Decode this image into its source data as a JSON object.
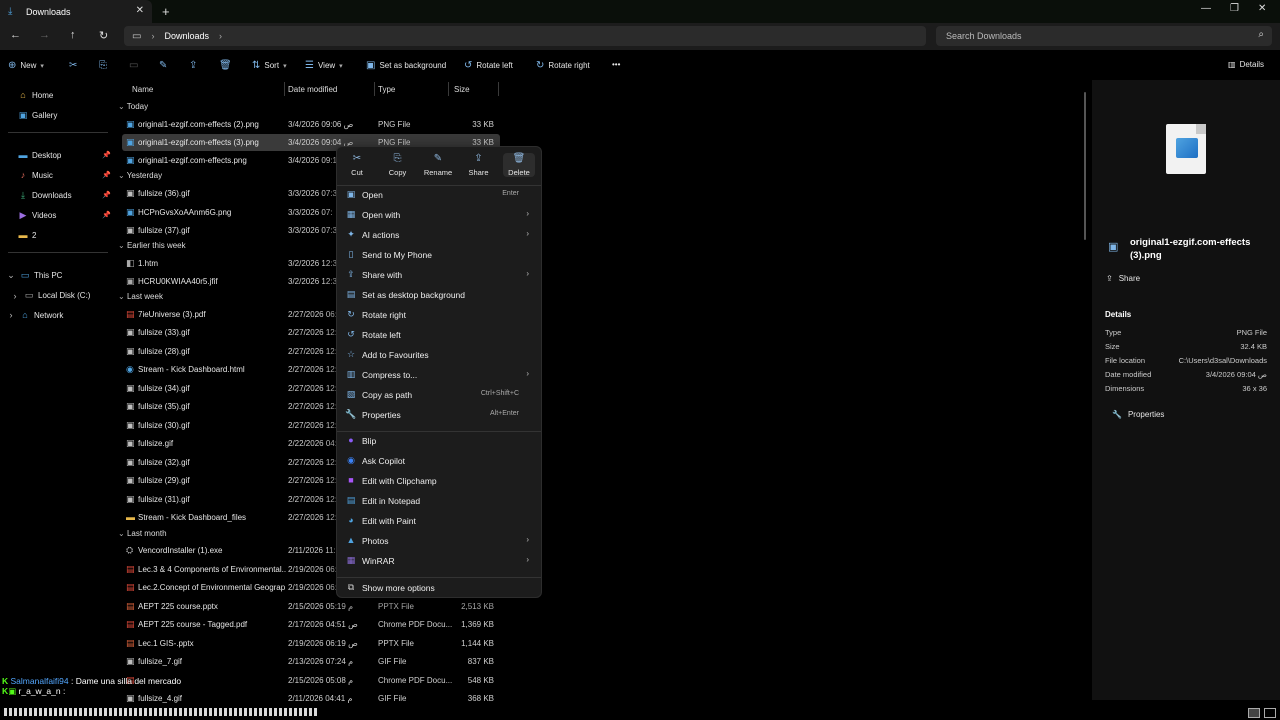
{
  "tab": {
    "title": "Downloads",
    "close": "✕",
    "new": "+"
  },
  "window_controls": [
    "—",
    "❐",
    "✕"
  ],
  "addressbar": {
    "back": "←",
    "forward": "→",
    "up": "↑",
    "refresh": "↻",
    "computer_icon": "▭",
    "separator": "›",
    "crumb": "Downloads",
    "crumb_sep": "›",
    "search_placeholder": "Search Downloads",
    "search_icon": "⌕"
  },
  "toolbar": {
    "new": "New",
    "sort": "Sort",
    "view": "View",
    "set_background": "Set as background",
    "rotate_left": "Rotate left",
    "rotate_right": "Rotate right",
    "more": "•••",
    "details": "Details"
  },
  "sidebar": {
    "items": [
      {
        "label": "Home",
        "icon": "home-icon"
      },
      {
        "label": "Gallery",
        "icon": "gallery-icon"
      },
      {
        "label": "Desktop",
        "icon": "folder-icon"
      },
      {
        "label": "Music",
        "icon": "music-icon"
      },
      {
        "label": "Downloads",
        "icon": "download-icon"
      },
      {
        "label": "Videos",
        "icon": "video-icon"
      },
      {
        "label": "2",
        "icon": "folder-icon"
      },
      {
        "label": "This PC",
        "icon": "pc-icon"
      },
      {
        "label": "Local Disk (C:)",
        "icon": "drive-icon"
      },
      {
        "label": "Network",
        "icon": "network-icon"
      }
    ]
  },
  "columns": {
    "name": "Name",
    "date": "Date modified",
    "type": "Type",
    "size": "Size"
  },
  "groups": [
    "Today",
    "Yesterday",
    "Earlier this week",
    "Last week",
    "Last month"
  ],
  "files": [
    {
      "name": "original1-ezgif.com-effects (2).png",
      "date": "3/4/2026 09:06 ص",
      "type": "PNG File",
      "size": "33 KB"
    },
    {
      "name": "original1-ezgif.com-effects (3).png",
      "date": "3/4/2026 09:04 ص",
      "type": "PNG File",
      "size": "33 KB"
    },
    {
      "name": "original1-ezgif.com-effects.png",
      "date": "3/4/2026 09:1",
      "type": "",
      "size": ""
    },
    {
      "name": "fullsize (36).gif",
      "date": "3/3/2026 07:3",
      "type": "",
      "size": ""
    },
    {
      "name": "HCPnGvsXoAAnm6G.png",
      "date": "3/3/2026 07:",
      "type": "",
      "size": ""
    },
    {
      "name": "fullsize (37).gif",
      "date": "3/3/2026 07:3",
      "type": "",
      "size": ""
    },
    {
      "name": "1.htm",
      "date": "3/2/2026 12:3",
      "type": "",
      "size": ""
    },
    {
      "name": "HCRU0KWIAA40r5.jfif",
      "date": "3/2/2026 12:3",
      "type": "",
      "size": ""
    },
    {
      "name": "7ieUniverse (3).pdf",
      "date": "2/27/2026 06:",
      "type": "",
      "size": ""
    },
    {
      "name": "fullsize (33).gif",
      "date": "2/27/2026 12:",
      "type": "",
      "size": ""
    },
    {
      "name": "fullsize (28).gif",
      "date": "2/27/2026 12:",
      "type": "",
      "size": ""
    },
    {
      "name": "Stream - Kick Dashboard.html",
      "date": "2/27/2026 12:",
      "type": "",
      "size": ""
    },
    {
      "name": "fullsize (34).gif",
      "date": "2/27/2026 12:",
      "type": "",
      "size": ""
    },
    {
      "name": "fullsize (35).gif",
      "date": "2/27/2026 12:",
      "type": "",
      "size": ""
    },
    {
      "name": "fullsize (30).gif",
      "date": "2/27/2026 12:",
      "type": "",
      "size": ""
    },
    {
      "name": "fullsize.gif",
      "date": "2/22/2026 04:",
      "type": "",
      "size": ""
    },
    {
      "name": "fullsize (32).gif",
      "date": "2/27/2026 12:",
      "type": "",
      "size": ""
    },
    {
      "name": "fullsize (29).gif",
      "date": "2/27/2026 12:",
      "type": "",
      "size": ""
    },
    {
      "name": "fullsize (31).gif",
      "date": "2/27/2026 12:",
      "type": "",
      "size": ""
    },
    {
      "name": "Stream - Kick Dashboard_files",
      "date": "2/27/2026 12:",
      "type": "",
      "size": ""
    },
    {
      "name": "VencordInstaller (1).exe",
      "date": "2/11/2026 11:",
      "type": "",
      "size": ""
    },
    {
      "name": "Lec.3 & 4  Components of Environmental...",
      "date": "2/19/2026 06:",
      "type": "",
      "size": ""
    },
    {
      "name": "Lec.2.Concept of Environmental Geograp...",
      "date": "2/19/2026 06:",
      "type": "",
      "size": ""
    },
    {
      "name": "AEPT 225 course.pptx",
      "date": "2/15/2026 05:19 م",
      "type": "PPTX File",
      "size": "2,513 KB"
    },
    {
      "name": "AEPT 225 course - Tagged.pdf",
      "date": "2/17/2026 04:51 ص",
      "type": "Chrome PDF Docu...",
      "size": "1,369 KB"
    },
    {
      "name": "Lec.1 GIS-.pptx",
      "date": "2/19/2026 06:19 ص",
      "type": "PPTX File",
      "size": "1,144 KB"
    },
    {
      "name": "fullsize_7.gif",
      "date": "2/13/2026 07:24 م",
      "type": "GIF File",
      "size": "837 KB"
    },
    {
      "name": "",
      "date": "2/15/2026 05:08 م",
      "type": "Chrome PDF Docu...",
      "size": "548 KB"
    },
    {
      "name": "fullsize_4.gif",
      "date": "2/11/2026 04:41 م",
      "type": "GIF File",
      "size": "368 KB"
    }
  ],
  "context_menu": {
    "top_actions": [
      {
        "label": "Cut",
        "icon": "✂"
      },
      {
        "label": "Copy",
        "icon": "⎘"
      },
      {
        "label": "Rename",
        "icon": "✎"
      },
      {
        "label": "Share",
        "icon": "⇪"
      },
      {
        "label": "Delete",
        "icon": "🗑"
      }
    ],
    "items": [
      {
        "label": "Open",
        "shortcut": "Enter",
        "icon": "▣",
        "submenu": false
      },
      {
        "label": "Open with",
        "shortcut": "",
        "icon": "▦",
        "submenu": true
      },
      {
        "label": "AI actions",
        "shortcut": "",
        "icon": "✦",
        "submenu": true
      },
      {
        "label": "Send to My Phone",
        "shortcut": "",
        "icon": "▯",
        "submenu": false
      },
      {
        "label": "Share with",
        "shortcut": "",
        "icon": "⇪",
        "submenu": true
      },
      {
        "label": "Set as desktop background",
        "shortcut": "",
        "icon": "▤",
        "submenu": false
      },
      {
        "label": "Rotate right",
        "shortcut": "",
        "icon": "↻",
        "submenu": false
      },
      {
        "label": "Rotate left",
        "shortcut": "",
        "icon": "↺",
        "submenu": false
      },
      {
        "label": "Add to Favourites",
        "shortcut": "",
        "icon": "☆",
        "submenu": false
      },
      {
        "label": "Compress to...",
        "shortcut": "",
        "icon": "▥",
        "submenu": true
      },
      {
        "label": "Copy as path",
        "shortcut": "Ctrl+Shift+C",
        "icon": "▧",
        "submenu": false
      },
      {
        "label": "Properties",
        "shortcut": "Alt+Enter",
        "icon": "🔧",
        "submenu": false
      }
    ],
    "apps": [
      {
        "label": "Blip",
        "icon": "●",
        "submenu": false
      },
      {
        "label": "Ask Copilot",
        "icon": "◉",
        "submenu": false
      },
      {
        "label": "Edit with Clipchamp",
        "icon": "■",
        "submenu": false
      },
      {
        "label": "Edit in Notepad",
        "icon": "▤",
        "submenu": false
      },
      {
        "label": "Edit with Paint",
        "icon": "◕",
        "submenu": false
      },
      {
        "label": "Photos",
        "icon": "▲",
        "submenu": true
      },
      {
        "label": "WinRAR",
        "icon": "▦",
        "submenu": true
      }
    ],
    "more": "Show more options"
  },
  "details_pane": {
    "filename": "original1-ezgif.com-effects (3).png",
    "share": "Share",
    "heading": "Details",
    "rows": [
      {
        "key": "Type",
        "value": "PNG File"
      },
      {
        "key": "Size",
        "value": "32.4 KB"
      },
      {
        "key": "File location",
        "value": "C:\\Users\\d3sal\\Downloads"
      },
      {
        "key": "Date modified",
        "value": "3/4/2026 09:04 ص"
      },
      {
        "key": "Dimensions",
        "value": "36 x 36"
      }
    ],
    "properties": "Properties"
  },
  "chat": [
    {
      "user": "Salmanalfaifi94",
      "sep": " : ",
      "msg": "Dame una silla del mercado"
    },
    {
      "user": "r_a_w_a_n",
      "sep": " :",
      "msg": ""
    }
  ]
}
